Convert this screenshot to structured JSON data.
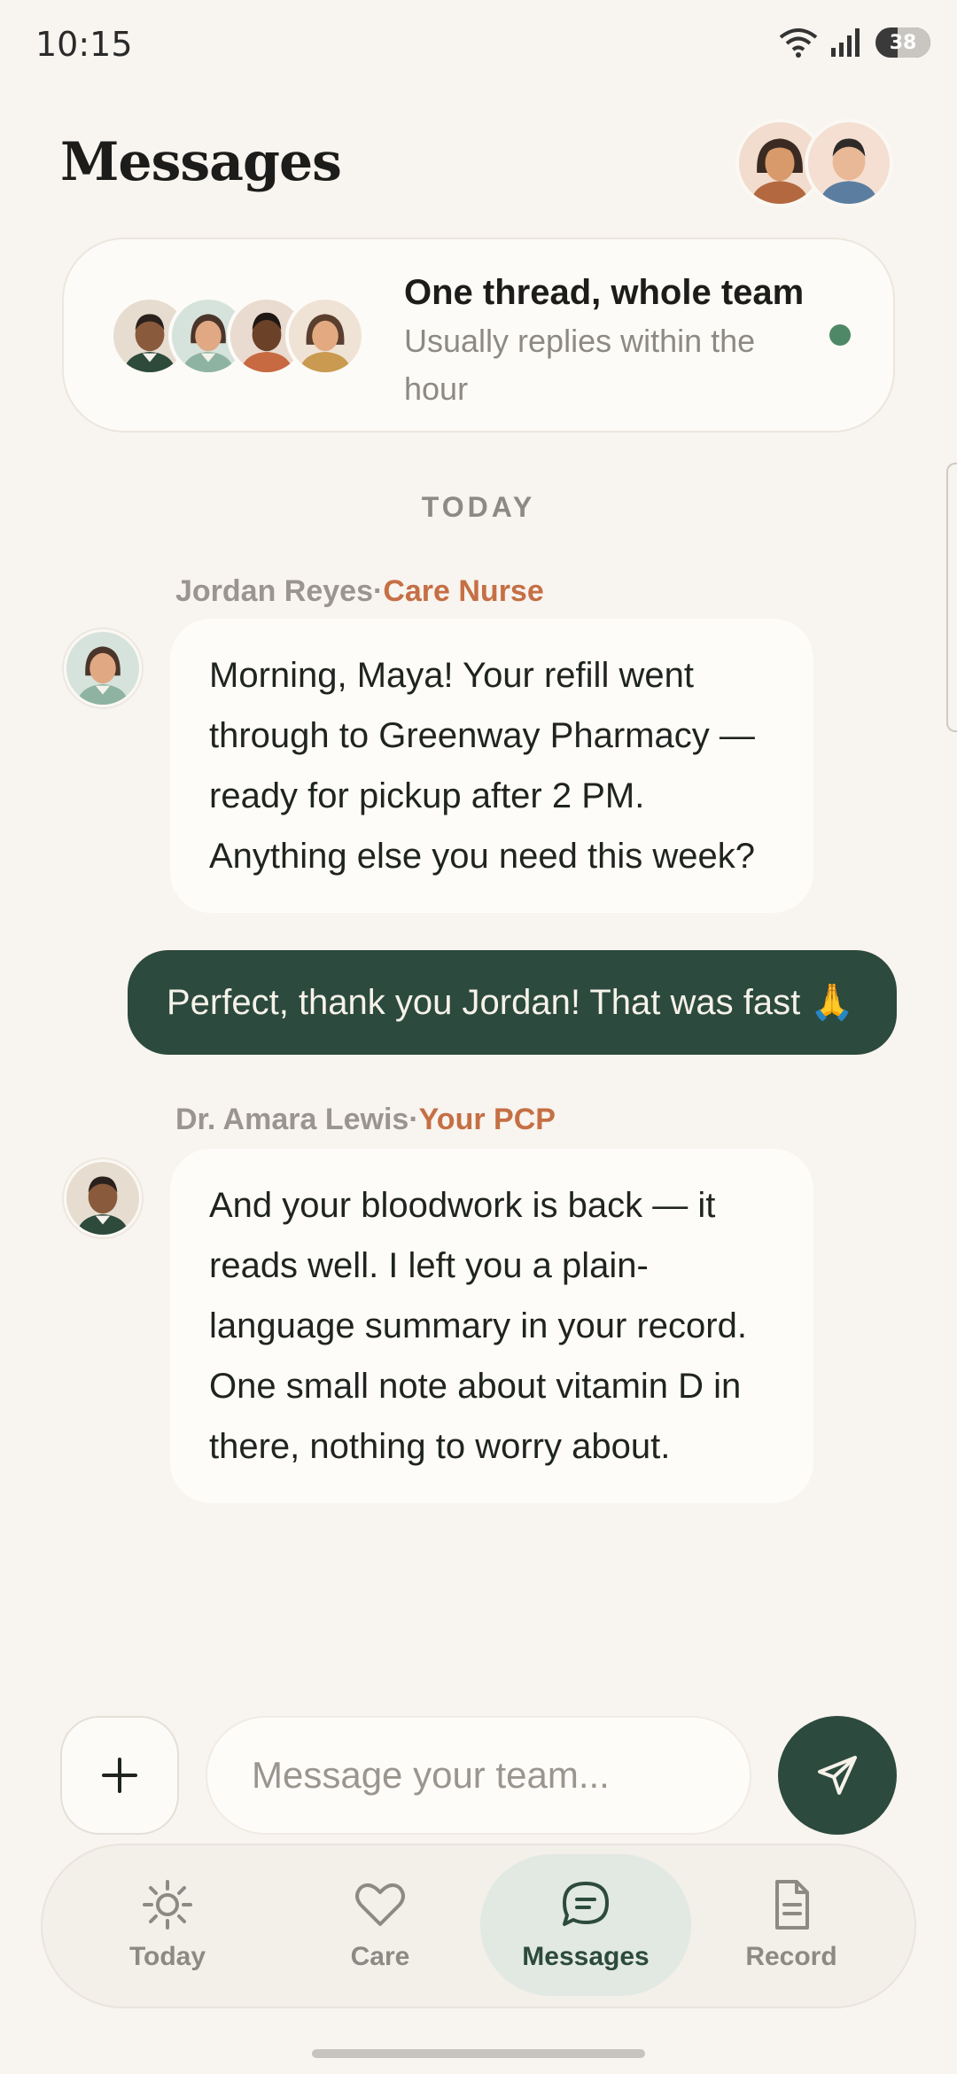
{
  "status_bar": {
    "time": "10:15",
    "battery": "38"
  },
  "header": {
    "title": "Messages"
  },
  "team_card": {
    "title": "One thread, whole team",
    "subtitle": "Usually replies within the hour",
    "online_color": "#4f8866"
  },
  "thread": {
    "day_label": "TODAY",
    "messages": [
      {
        "sender_name": "Jordan Reyes",
        "separator": "·",
        "sender_role": "Care Nurse",
        "text": "Morning, Maya! Your refill went through to Greenway Pharmacy — ready for pickup after 2 PM. Anything else you need this week?"
      },
      {
        "text": "Perfect, thank you Jordan! That was fast 🙏"
      },
      {
        "sender_name": "Dr. Amara Lewis",
        "separator": "·",
        "sender_role": "Your PCP",
        "text": "And your bloodwork is back — it reads well. I left you a plain-language summary in your record. One small note about vitamin D in there, nothing to worry about."
      }
    ]
  },
  "composer": {
    "placeholder": "Message your team...",
    "attach_icon": "plus-icon",
    "send_icon": "send-icon"
  },
  "tabbar": {
    "tabs": [
      {
        "label": "Today",
        "icon": "sun-icon"
      },
      {
        "label": "Care",
        "icon": "heart-icon"
      },
      {
        "label": "Messages",
        "icon": "chat-icon",
        "active": true
      },
      {
        "label": "Record",
        "icon": "document-icon"
      }
    ]
  },
  "colors": {
    "accent": "#2c4a3d",
    "role": "#c56f45",
    "background": "#f8f4ef"
  }
}
